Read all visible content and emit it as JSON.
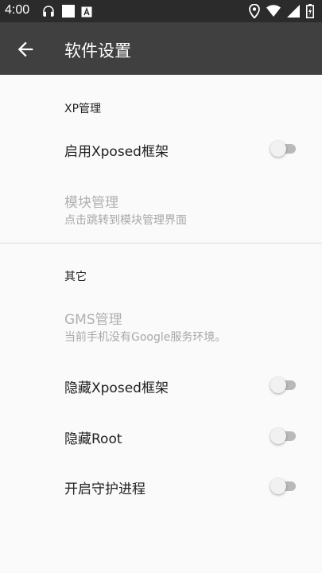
{
  "status_bar": {
    "time": "4:00",
    "left_icons": [
      "headset-icon",
      "white-square-icon",
      "a-box-icon"
    ],
    "right_icons": [
      "location-icon",
      "wifi-icon",
      "signal-icon",
      "battery-charging-icon"
    ]
  },
  "app_bar": {
    "back_icon": "arrow-back-icon",
    "title": "软件设置"
  },
  "sections": {
    "xp": {
      "header": "XP管理",
      "enable_xposed": {
        "label": "启用Xposed框架",
        "checked": false
      },
      "module_manage": {
        "label": "模块管理",
        "summary": "点击跳转到模块管理界面",
        "enabled": false
      }
    },
    "other": {
      "header": "其它",
      "gms_manage": {
        "label": "GMS管理",
        "summary": "当前手机没有Google服务环境。",
        "enabled": false
      },
      "hide_xposed": {
        "label": "隐藏Xposed框架",
        "checked": false
      },
      "hide_root": {
        "label": "隐藏Root",
        "checked": false
      },
      "guard_process": {
        "label": "开启守护进程",
        "checked": false
      }
    }
  },
  "colors": {
    "status_bar": "#2b2b2b",
    "app_bar": "#404040",
    "background": "#fafafa",
    "disabled_text": "#b0b0b0",
    "switch_track_off": "#b9b9b9",
    "switch_thumb_off": "#f1f1f1"
  }
}
